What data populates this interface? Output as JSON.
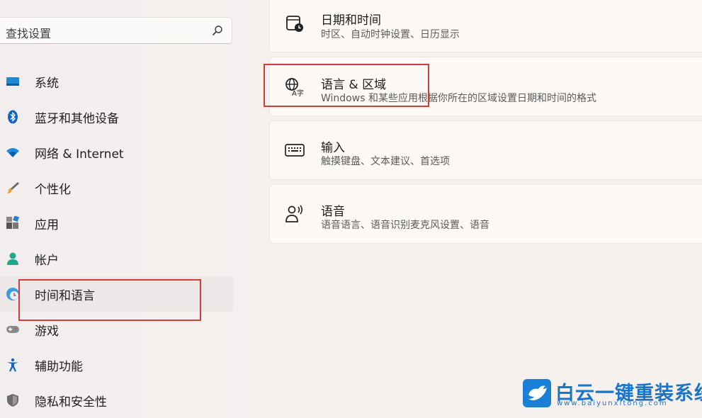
{
  "search": {
    "placeholder": "查找设置"
  },
  "sidebar": {
    "items": [
      {
        "label": "系统",
        "icon": "system-icon"
      },
      {
        "label": "蓝牙和其他设备",
        "icon": "bluetooth-icon"
      },
      {
        "label": "网络 & Internet",
        "icon": "wifi-icon"
      },
      {
        "label": "个性化",
        "icon": "brush-icon"
      },
      {
        "label": "应用",
        "icon": "apps-icon"
      },
      {
        "label": "帐户",
        "icon": "account-icon"
      },
      {
        "label": "时间和语言",
        "icon": "time-language-icon",
        "selected": true
      },
      {
        "label": "游戏",
        "icon": "gamepad-icon"
      },
      {
        "label": "辅助功能",
        "icon": "accessibility-icon"
      },
      {
        "label": "隐私和安全性",
        "icon": "shield-icon"
      }
    ]
  },
  "cards": [
    {
      "title": "日期和时间",
      "subtitle": "时区、自动时钟设置、日历显示",
      "icon": "calendar-clock-icon"
    },
    {
      "title": "语言 & 区域",
      "subtitle": "Windows 和某些应用根据你所在的区域设置日期和时间的格式",
      "icon": "language-icon"
    },
    {
      "title": "输入",
      "subtitle": "触摸键盘、文本建议、首选项",
      "icon": "keyboard-icon"
    },
    {
      "title": "语音",
      "subtitle": "语音语言、语音识别麦克风设置、语音",
      "icon": "speech-icon"
    }
  ],
  "watermark": {
    "title": "白云一键重装系统",
    "url": "www.baiyunxitong.com"
  },
  "colors": {
    "highlight": "#d43c3c",
    "accent": "#0067c0",
    "watermark": "#1a74c9"
  }
}
